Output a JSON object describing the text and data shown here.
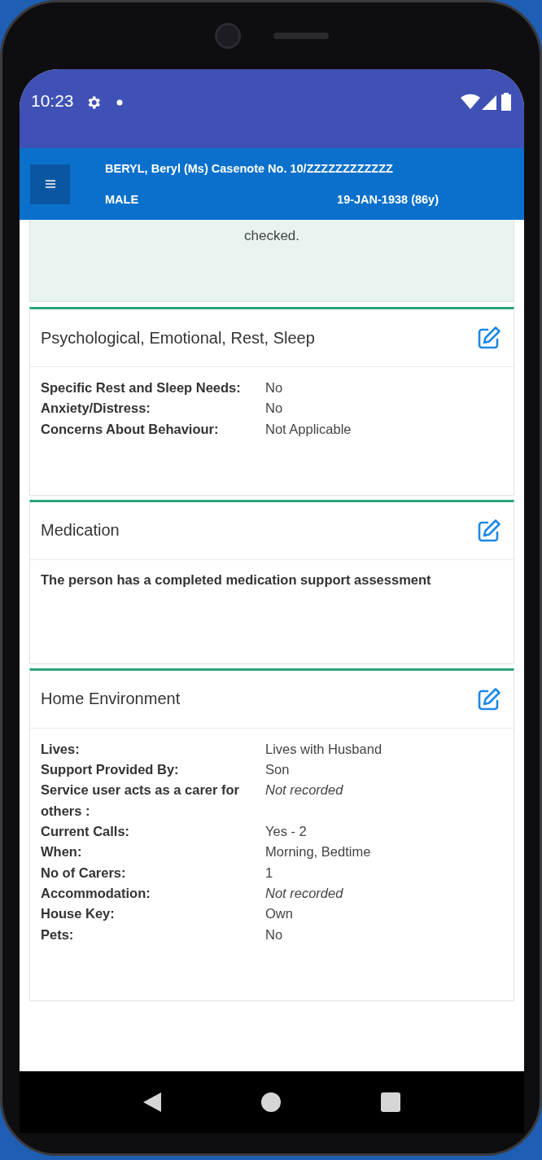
{
  "status_bar": {
    "time": "10:23"
  },
  "header": {
    "title": "BERYL, Beryl (Ms) Casenote No. 10/ZZZZZZZZZZZZ",
    "gender": "MALE",
    "dob": "19-JAN-1938 (86y)"
  },
  "previous_card": {
    "text": "checked."
  },
  "cards": [
    {
      "title": "Psychological, Emotional, Rest, Sleep",
      "kind": "fields",
      "fields": [
        {
          "label": "Specific Rest and Sleep Needs:",
          "value": "No",
          "kind": "value"
        },
        {
          "label": "Anxiety/Distress:",
          "value": "No",
          "kind": "value"
        },
        {
          "label": "Concerns About Behaviour:",
          "value": "Not Applicable",
          "kind": "value"
        }
      ]
    },
    {
      "title": "Medication",
      "kind": "statement",
      "statement": "The person has a completed medication support assessment"
    },
    {
      "title": "Home Environment",
      "kind": "fields",
      "fields": [
        {
          "label": "Lives:",
          "value": "Lives with Husband",
          "kind": "value"
        },
        {
          "label": "Support Provided By:",
          "value": "Son",
          "kind": "value"
        },
        {
          "label": "Service user acts as a carer for others :",
          "value": "Not recorded",
          "kind": "missing"
        },
        {
          "label": "Current Calls:",
          "value": "Yes - 2",
          "kind": "value"
        },
        {
          "label": "When:",
          "value": "Morning, Bedtime",
          "kind": "value"
        },
        {
          "label": "No of Carers:",
          "value": "1",
          "kind": "value"
        },
        {
          "label": "Accommodation:",
          "value": "Not recorded",
          "kind": "missing"
        },
        {
          "label": "House Key:",
          "value": "Own",
          "kind": "value"
        },
        {
          "label": "Pets:",
          "value": "No",
          "kind": "value"
        }
      ]
    }
  ]
}
